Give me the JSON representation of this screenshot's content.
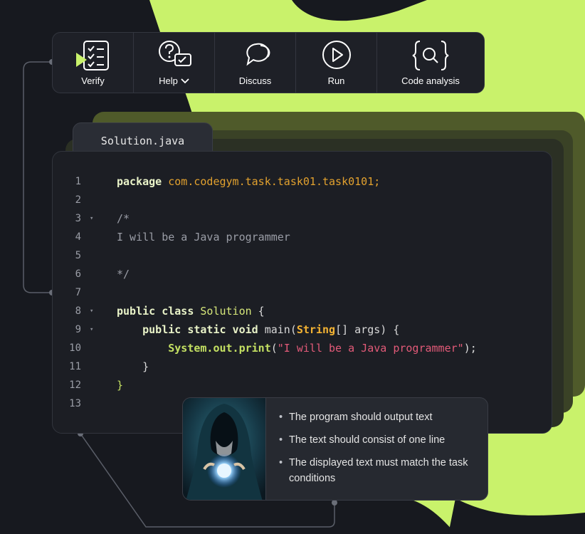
{
  "colors": {
    "accent_green": "#c9f26b",
    "background": "#17191f",
    "panel": "#1e2027",
    "editor": "#1c1e24"
  },
  "toolbar": {
    "items": [
      {
        "label": "Verify",
        "icon": "verify-icon"
      },
      {
        "label": "Help",
        "icon": "help-icon",
        "dropdown": true
      },
      {
        "label": "Discuss",
        "icon": "discuss-icon"
      },
      {
        "label": "Run",
        "icon": "run-icon"
      },
      {
        "label": "Code analysis",
        "icon": "code-analysis-icon"
      }
    ]
  },
  "file_tab": {
    "name": "Solution.java"
  },
  "editor": {
    "lines": [
      {
        "num": "1",
        "fold": false,
        "tokens": [
          [
            "kw",
            "package"
          ],
          [
            "plain",
            " "
          ],
          [
            "pkg",
            "com.codegym.task.task01.task0101;"
          ]
        ]
      },
      {
        "num": "2",
        "fold": false,
        "tokens": []
      },
      {
        "num": "3",
        "fold": true,
        "tokens": [
          [
            "cmt",
            "/*"
          ]
        ]
      },
      {
        "num": "4",
        "fold": false,
        "tokens": [
          [
            "cmt",
            "I will be a Java programmer"
          ]
        ]
      },
      {
        "num": "5",
        "fold": false,
        "tokens": []
      },
      {
        "num": "6",
        "fold": false,
        "tokens": [
          [
            "cmt",
            "*/"
          ]
        ]
      },
      {
        "num": "7",
        "fold": false,
        "tokens": []
      },
      {
        "num": "8",
        "fold": true,
        "tokens": [
          [
            "kw",
            "public class"
          ],
          [
            "plain",
            " "
          ],
          [
            "cls",
            "Solution"
          ],
          [
            "plain",
            " {"
          ]
        ]
      },
      {
        "num": "9",
        "fold": true,
        "tokens": [
          [
            "plain",
            "    "
          ],
          [
            "kw",
            "public static void"
          ],
          [
            "plain",
            " main("
          ],
          [
            "typ",
            "String"
          ],
          [
            "plain",
            "[] args) {"
          ]
        ]
      },
      {
        "num": "10",
        "fold": false,
        "tokens": [
          [
            "plain",
            "        "
          ],
          [
            "sys",
            "System.out.print"
          ],
          [
            "plain",
            "("
          ],
          [
            "str",
            "\"I will be a Java programmer\""
          ],
          [
            "plain",
            ");"
          ]
        ]
      },
      {
        "num": "11",
        "fold": false,
        "tokens": [
          [
            "plain",
            "    }"
          ]
        ]
      },
      {
        "num": "12",
        "fold": false,
        "tokens": [
          [
            "brace",
            "}"
          ]
        ]
      },
      {
        "num": "13",
        "fold": false,
        "tokens": []
      }
    ]
  },
  "task": {
    "avatar": "hooded-mentor-avatar",
    "requirements": [
      "The program should output text",
      "The text should consist of one line",
      "The displayed text must match the task conditions"
    ]
  }
}
